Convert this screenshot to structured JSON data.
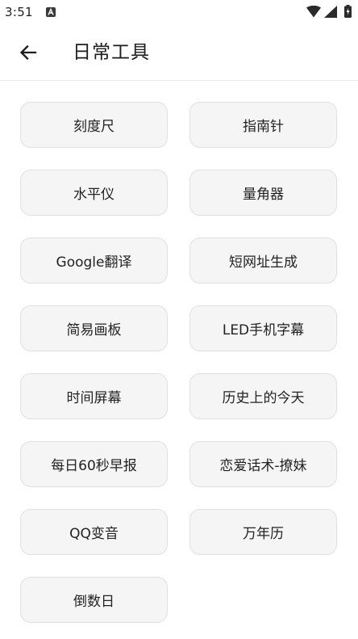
{
  "status_bar": {
    "time": "3:51",
    "icons": [
      "notification-a-icon",
      "wifi-icon",
      "signal-icon",
      "battery-icon"
    ]
  },
  "app_bar": {
    "title": "日常工具",
    "back_icon": "arrow-left-icon"
  },
  "tools": [
    {
      "label": "刻度尺"
    },
    {
      "label": "指南针"
    },
    {
      "label": "水平仪"
    },
    {
      "label": "量角器"
    },
    {
      "label": "Google翻译"
    },
    {
      "label": "短网址生成"
    },
    {
      "label": "简易画板"
    },
    {
      "label": "LED手机字幕"
    },
    {
      "label": "时间屏幕"
    },
    {
      "label": "历史上的今天"
    },
    {
      "label": "每日60秒早报"
    },
    {
      "label": "恋爱话术-撩妹"
    },
    {
      "label": "QQ变音"
    },
    {
      "label": "万年历"
    },
    {
      "label": "倒数日"
    }
  ],
  "colors": {
    "button_bg": "#f5f5f5",
    "button_border": "#e0e0e0",
    "text": "#222222"
  }
}
